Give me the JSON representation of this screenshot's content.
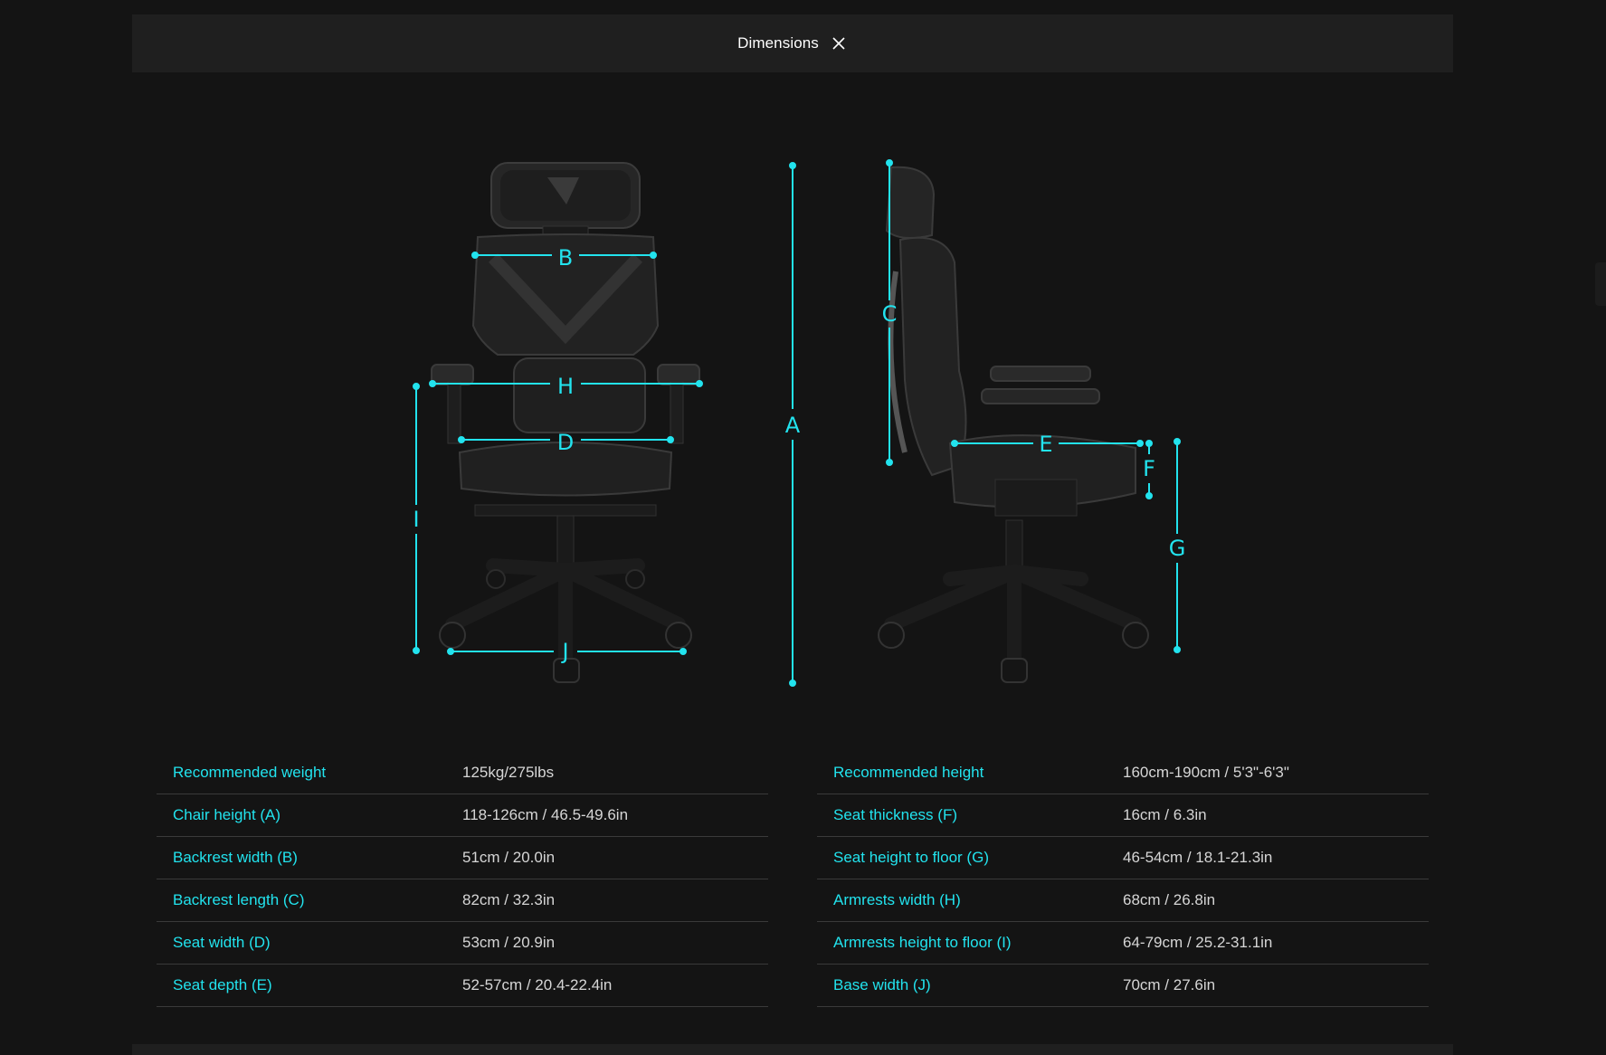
{
  "header": {
    "title": "Dimensions"
  },
  "dimension_letters": {
    "a": "A",
    "b": "B",
    "c": "C",
    "d": "D",
    "e": "E",
    "f": "F",
    "g": "G",
    "h": "H",
    "i": "I",
    "j": "J"
  },
  "colors": {
    "accent": "#22e3ee",
    "background": "#141414",
    "panel": "#1f1f1f"
  },
  "specs_left": [
    {
      "label": "Recommended weight",
      "value": "125kg/275lbs"
    },
    {
      "label": "Chair height (A)",
      "value": "118-126cm / 46.5-49.6in"
    },
    {
      "label": "Backrest width (B)",
      "value": "51cm / 20.0in"
    },
    {
      "label": "Backrest length (C)",
      "value": "82cm / 32.3in"
    },
    {
      "label": "Seat width (D)",
      "value": "53cm / 20.9in"
    },
    {
      "label": "Seat depth (E)",
      "value": "52-57cm / 20.4-22.4in"
    }
  ],
  "specs_right": [
    {
      "label": "Recommended height",
      "value": "160cm-190cm / 5'3\"-6'3\""
    },
    {
      "label": "Seat thickness (F)",
      "value": "16cm / 6.3in"
    },
    {
      "label": "Seat height to floor (G)",
      "value": "46-54cm / 18.1-21.3in"
    },
    {
      "label": "Armrests width (H)",
      "value": "68cm / 26.8in"
    },
    {
      "label": "Armrests height to floor (I)",
      "value": "64-79cm / 25.2-31.1in"
    },
    {
      "label": "Base width (J)",
      "value": "70cm / 27.6in"
    }
  ]
}
